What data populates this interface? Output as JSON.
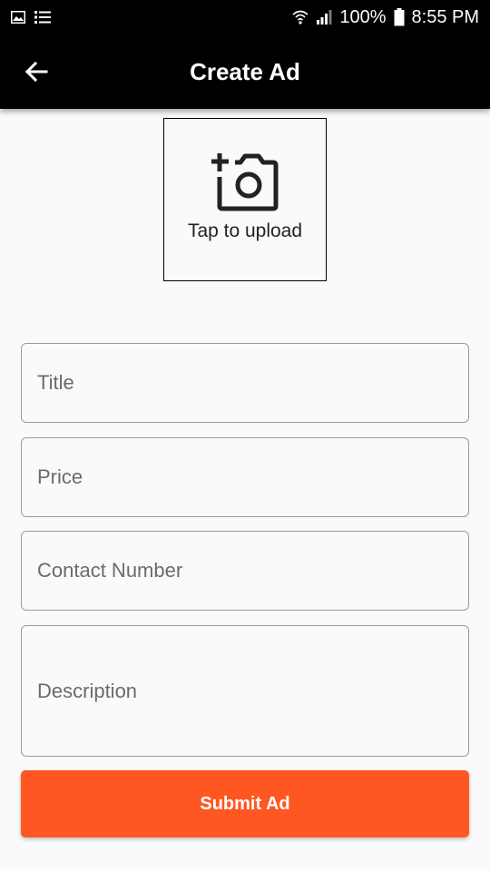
{
  "status_bar": {
    "battery": "100%",
    "time": "8:55 PM",
    "icons": [
      "image-icon",
      "list-icon",
      "wifi-icon",
      "signal-icon",
      "battery-icon"
    ]
  },
  "app_bar": {
    "title": "Create Ad",
    "back_icon": "arrow-left-icon"
  },
  "upload": {
    "icon": "add-photo-icon",
    "label": "Tap to upload"
  },
  "form": {
    "title_placeholder": "Title",
    "price_placeholder": "Price",
    "contact_placeholder": "Contact Number",
    "description_placeholder": "Description"
  },
  "submit": {
    "label": "Submit Ad"
  },
  "colors": {
    "accent": "#ff5722",
    "app_bar": "#000000",
    "background": "#fafafa",
    "field_border": "#9a9a9a"
  }
}
